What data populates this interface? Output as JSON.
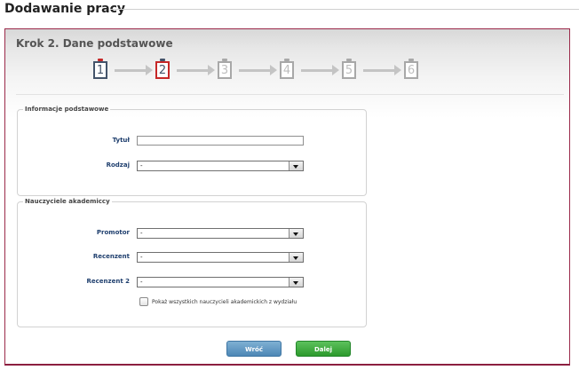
{
  "page": {
    "title": "Dodawanie pracy"
  },
  "wizard": {
    "step_title": "Krok 2. Dane podstawowe",
    "current_step": 2,
    "steps": [
      "1",
      "2",
      "3",
      "4",
      "5",
      "6"
    ]
  },
  "basic_info": {
    "legend": "Informacje podstawowe",
    "title_label": "Tytuł",
    "title_value": "",
    "type_label": "Rodzaj",
    "type_value": "-"
  },
  "teachers": {
    "legend": "Nauczyciele akademiccy",
    "promotor_label": "Promotor",
    "promotor_value": "-",
    "reviewer_label": "Recenzent",
    "reviewer_value": "-",
    "reviewer2_label": "Recenzent 2",
    "reviewer2_value": "-",
    "show_all_label": "Pokaż wszystkich nauczycieli akademickich z wydziału",
    "show_all_checked": false
  },
  "buttons": {
    "back": "Wróć",
    "next": "Dalej"
  },
  "colors": {
    "panel_border": "#9b2a4a",
    "label_blue": "#1f3f6e",
    "current_step_red": "#c62828",
    "back_button_blue": "#4d87b6",
    "next_button_green": "#2c9a2c"
  }
}
